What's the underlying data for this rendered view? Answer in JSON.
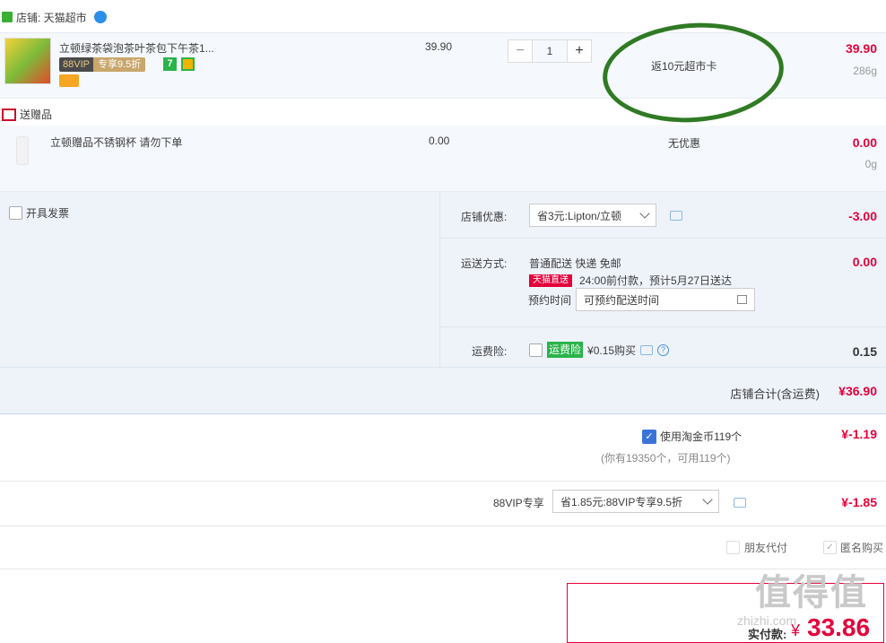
{
  "store": {
    "label": "店铺: 天猫超市"
  },
  "item": {
    "title": "立顿绿茶袋泡茶叶茶包下午茶1...",
    "vip_a": "88VIP",
    "vip_b": "专享9.5折",
    "badge_7": "7",
    "unit_price": "39.90",
    "quantity": "1",
    "minus": "−",
    "plus": "+",
    "promo": "返10元超市卡",
    "total": "39.90",
    "weight": "286g"
  },
  "gift": {
    "section_label": "送赠品",
    "title": "立顿赠品不锈钢杯 请勿下单",
    "price": "0.00",
    "promo": "无优惠",
    "total": "0.00",
    "weight": "0g"
  },
  "invoice": {
    "label": "开具发票"
  },
  "store_coupon": {
    "label": "店铺优惠:",
    "selected": "省3元:Lipton/立顿",
    "amount": "-3.00"
  },
  "shipping": {
    "label": "运送方式:",
    "method": "普通配送 快递 免邮",
    "tmall_tag": "天猫直送",
    "eta": "24:00前付款，预计5月27日送达",
    "appointment_label": "预约时间",
    "appointment_placeholder": "可预约配送时间",
    "amount": "0.00"
  },
  "freight_insurance": {
    "label": "运费险:",
    "tag": "运费险",
    "price": "¥0.15购买",
    "help": "?",
    "amount": "0.15"
  },
  "store_total": {
    "label": "店铺合计(含运费)",
    "amount": "¥36.90"
  },
  "taojinbi": {
    "label": "使用淘金币119个",
    "note": "(你有19350个，可用119个)",
    "amount": "¥-1.19"
  },
  "vip88": {
    "label": "88VIP专享",
    "selected": "省1.85元:88VIP专享9.5折",
    "amount": "¥-1.85"
  },
  "options": {
    "friend_pay": "朋友代付",
    "anonymous": "匿名购买"
  },
  "payment": {
    "label": "实付款:",
    "currency": "¥",
    "amount": "33.86"
  },
  "watermark": {
    "text": "值得值",
    "sub": "zhizhi.com"
  },
  "colors": {
    "accent_red": "#e4003a",
    "green_circle": "#2f7a23",
    "panel_bg": "#eef3fa"
  }
}
